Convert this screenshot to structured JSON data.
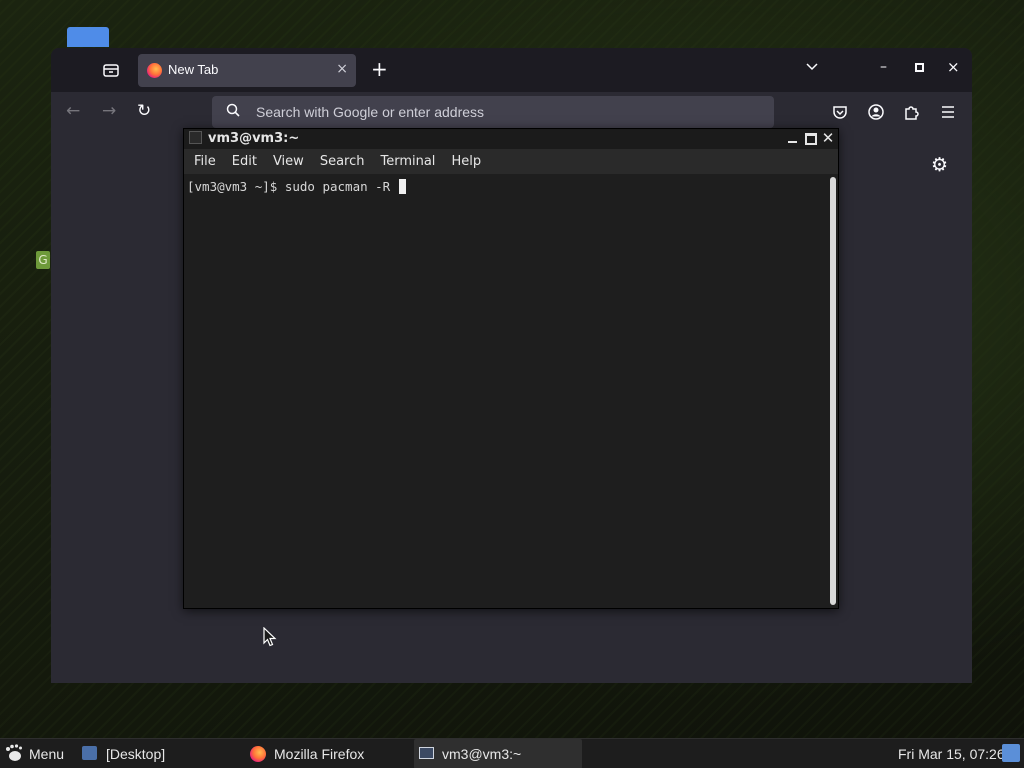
{
  "desktop": {
    "folder_icon": "folder-icon",
    "badge_letter": "G"
  },
  "firefox": {
    "tab": {
      "title": "New Tab",
      "close": "×",
      "favicon": "firefox-icon"
    },
    "newtab_label": "+",
    "urlbar": {
      "placeholder": "Search with Google or enter address",
      "value": ""
    },
    "controls": {
      "minimize": "–",
      "close": "×"
    },
    "nav": {
      "back": "←",
      "forward": "→",
      "reload": "↻"
    },
    "settings_glyph": "⚙"
  },
  "terminal": {
    "title": "vm3@vm3:~",
    "menu": [
      "File",
      "Edit",
      "View",
      "Search",
      "Terminal",
      "Help"
    ],
    "prompt_line": "[vm3@vm3 ~]$ sudo pacman -R ",
    "close_glyph": "✕"
  },
  "taskbar": {
    "menu_label": "Menu",
    "items": [
      {
        "label": "[Desktop]",
        "icon": "desktop-icon"
      },
      {
        "label": "Mozilla Firefox",
        "icon": "firefox-icon"
      },
      {
        "label": "vm3@vm3:~",
        "icon": "terminal-icon",
        "active": true
      }
    ],
    "clock": "Fri Mar 15, 07:26"
  },
  "colors": {
    "firefox_bg": "#2b2a33",
    "firefox_tabbar": "#1c1b22",
    "terminal_bg": "#1e1e1e",
    "taskbar_bg": "#1d1d1d",
    "accent_blue": "#4f8ce8"
  }
}
